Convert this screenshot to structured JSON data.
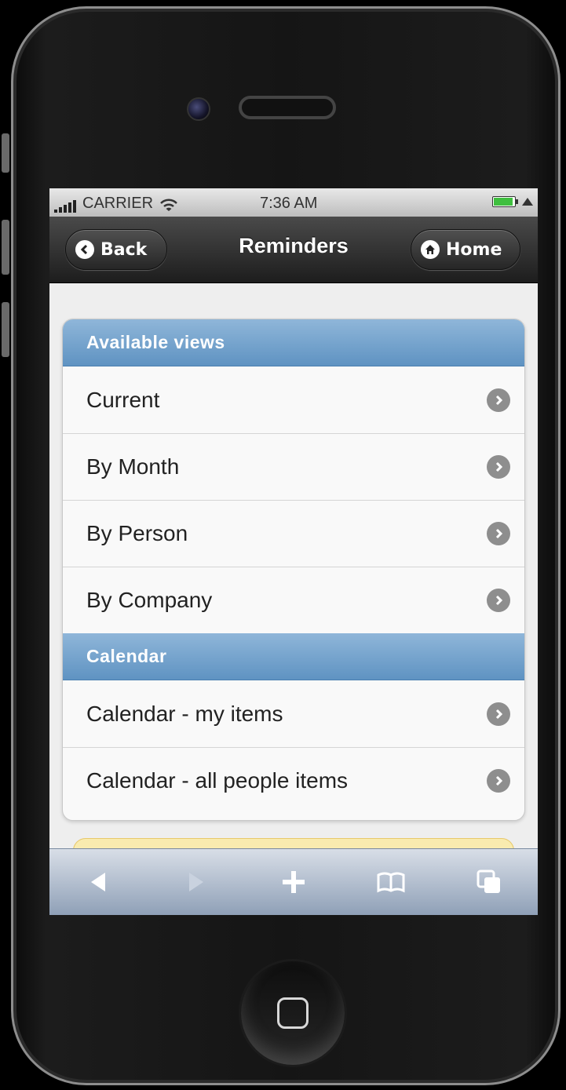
{
  "status_bar": {
    "carrier": "CARRIER",
    "time": "7:36 AM"
  },
  "nav": {
    "back_label": "Back",
    "title": "Reminders",
    "home_label": "Home"
  },
  "sections": [
    {
      "header": "Available views",
      "items": [
        {
          "label": "Current"
        },
        {
          "label": "By Month"
        },
        {
          "label": "By Person"
        },
        {
          "label": "By Company"
        }
      ]
    },
    {
      "header": "Calendar",
      "items": [
        {
          "label": "Calendar - my items"
        },
        {
          "label": "Calendar - all people items"
        }
      ]
    }
  ],
  "toolbar": {
    "icons": [
      "back-arrow-icon",
      "forward-arrow-icon",
      "add-icon",
      "bookmarks-icon",
      "pages-icon"
    ]
  },
  "colors": {
    "divider": "#6f9fcd",
    "navbar": "#2b2b2b",
    "toolbar": "#a9b6c9"
  }
}
